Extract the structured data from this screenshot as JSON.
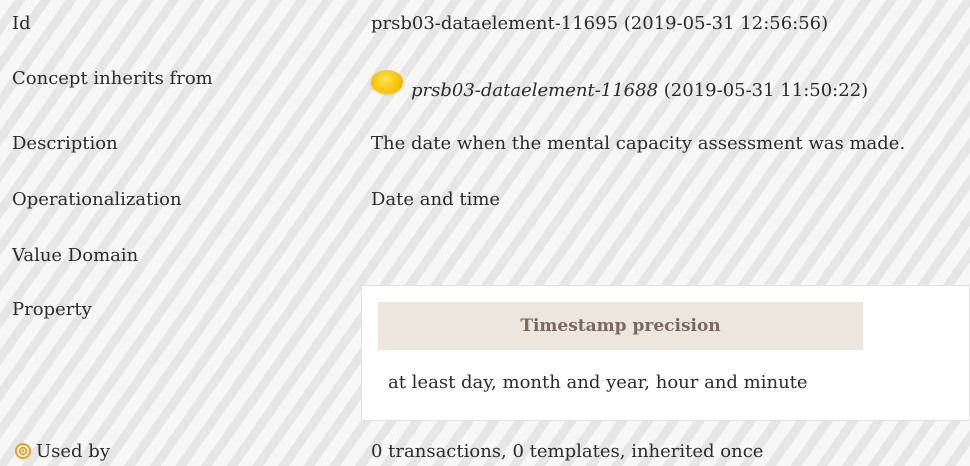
{
  "rows": {
    "id": {
      "label": "Id",
      "value": "prsb03-dataelement-11695 (2019-05-31 12:56:56)"
    },
    "inherits": {
      "label": "Concept inherits from",
      "ref_id": "prsb03-dataelement-11688",
      "ref_date": "(2019-05-31 11:50:22)"
    },
    "description": {
      "label": "Description",
      "value": "The date when the mental capacity assessment was made."
    },
    "operationalization": {
      "label": "Operationalization",
      "value": "Date and time"
    },
    "value_domain": {
      "label": "Value Domain",
      "value": ""
    },
    "property": {
      "label": "Property",
      "header": "Timestamp precision",
      "value": "at least day, month and year, hour and minute"
    },
    "used_by": {
      "label": "Used by",
      "value": "0 transactions, 0 templates, inherited once"
    }
  },
  "icons": {
    "inherit_orb": "yellow-orb-icon",
    "used_by": "target-icon"
  },
  "colors": {
    "orb": "#ffc400",
    "target_icon": "#f29a1a",
    "property_header_bg": "#ece6df",
    "property_header_text": "#7a6a5e"
  }
}
